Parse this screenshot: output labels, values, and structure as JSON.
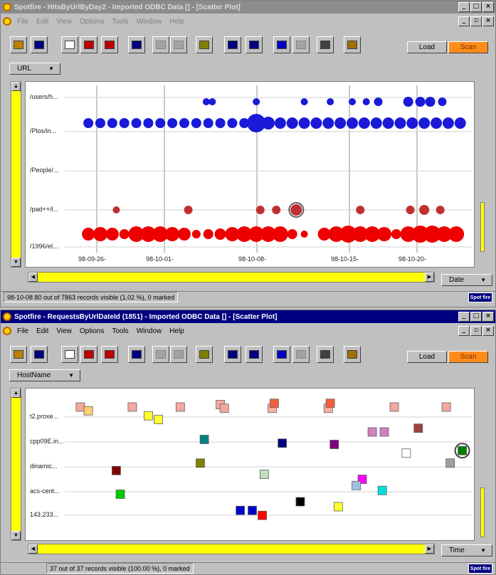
{
  "windows": [
    {
      "title": "Spotfire - HitsByUrlByDay2 - Imported ODBC Data [] - [Scatter Plot]",
      "menu": [
        "File",
        "Edit",
        "View",
        "Options",
        "Tools",
        "Window",
        "Help"
      ],
      "load_label": "Load",
      "scan_label": "Scan",
      "y_axis_selector": "URL",
      "x_axis_selector": "Date",
      "status": "98-10-08 80 out of 7863 records visible (1.02 %), 0 marked",
      "logo": "Spot fire"
    },
    {
      "title": "Spotfire - RequestsByUrlDateId (1851) - Imported ODBC Data [] - [Scatter Plot]",
      "menu": [
        "File",
        "Edit",
        "View",
        "Options",
        "Tools",
        "Window",
        "Help"
      ],
      "load_label": "Load",
      "scan_label": "Scan",
      "y_axis_selector": "HostName",
      "x_axis_selector": "Time",
      "status": "37 out of 37 records visible (100.00 %), 0 marked",
      "logo": "Spot fire"
    }
  ],
  "toolbar_icons": [
    "open-icon",
    "save-icon",
    "new-scatter-icon",
    "new-bar-icon",
    "new-pie-icon",
    "import-icon",
    "undo-icon",
    "zoom-icon",
    "query-device-icon",
    "copy-icon",
    "details-icon",
    "copy-to-clipboard-icon",
    "paste-icon",
    "print-icon",
    "help-icon"
  ],
  "chart_data": [
    {
      "type": "scatter",
      "y_categories": [
        "/users/h...",
        "/Plos/in...",
        "/People/...",
        "/pad++/l...",
        "/1996/el..."
      ],
      "x_ticks": [
        "98-09-26-",
        "98-10-01-",
        "98-10-08-",
        "98-10-15-",
        "98-10-20-"
      ],
      "colors": {
        "blue": "#1a1ad8",
        "red": "#ee0000",
        "darkred": "#c03030"
      },
      "series": [
        {
          "row": 0,
          "color": "blue",
          "x": [
            0.345,
            0.36,
            0.47,
            0.59,
            0.655,
            0.71,
            0.745,
            0.775,
            0.85,
            0.88,
            0.905,
            0.935
          ],
          "size": [
            5,
            5,
            5,
            5,
            5,
            5,
            5,
            6,
            7,
            7,
            7,
            6
          ]
        },
        {
          "row": 0.5,
          "color": "blue",
          "x": [
            0.05,
            0.08,
            0.11,
            0.14,
            0.17,
            0.2,
            0.23,
            0.26,
            0.29,
            0.32,
            0.35,
            0.38,
            0.41,
            0.44,
            0.47,
            0.5,
            0.53,
            0.56,
            0.59,
            0.62,
            0.65,
            0.68,
            0.71,
            0.74,
            0.77,
            0.8,
            0.83,
            0.86,
            0.89,
            0.92,
            0.95,
            0.98
          ],
          "size": [
            7,
            7,
            7,
            7,
            7,
            7,
            7,
            7,
            7,
            7,
            7,
            7,
            7,
            7,
            13,
            9,
            8,
            8,
            8,
            8,
            8,
            8,
            8,
            8,
            8,
            8,
            8,
            8,
            8,
            8,
            8,
            8
          ]
        },
        {
          "row": 3,
          "color": "darkred",
          "x": [
            0.12,
            0.3,
            0.48,
            0.52,
            0.57,
            0.73,
            0.855,
            0.89,
            0.93
          ],
          "size": [
            5,
            6,
            6,
            6,
            8,
            6,
            6,
            7,
            6
          ]
        },
        {
          "row": 3.98,
          "color": "red",
          "x": [
            0.05,
            0.08,
            0.11,
            0.14,
            0.17,
            0.2,
            0.23,
            0.26,
            0.29,
            0.32,
            0.35,
            0.38,
            0.41,
            0.44,
            0.47,
            0.5,
            0.53,
            0.56,
            0.59,
            0.64,
            0.67,
            0.7,
            0.73,
            0.76,
            0.79,
            0.82,
            0.85,
            0.88,
            0.91,
            0.94,
            0.97
          ],
          "size": [
            9,
            10,
            9,
            7,
            11,
            11,
            11,
            10,
            9,
            6,
            7,
            8,
            10,
            11,
            11,
            11,
            11,
            7,
            5,
            9,
            11,
            12,
            11,
            11,
            10,
            7,
            11,
            12,
            12,
            11,
            11
          ]
        }
      ]
    },
    {
      "type": "scatter",
      "y_categories": [
        "t2.proxe...",
        "cpp09E.in...",
        "dinamic...",
        "acs-cent...",
        "143.233..."
      ],
      "series": [
        {
          "color": "#f4a8a0",
          "x": [
            0.03
          ],
          "y": [
            -0.4
          ]
        },
        {
          "color": "#ffd070",
          "x": [
            0.05
          ],
          "y": [
            -0.25
          ]
        },
        {
          "color": "#f4a8a0",
          "x": [
            0.16
          ],
          "y": [
            -0.4
          ]
        },
        {
          "color": "#ffff30",
          "x": [
            0.2
          ],
          "y": [
            -0.05
          ]
        },
        {
          "color": "#ffff30",
          "x": [
            0.225
          ],
          "y": [
            0.1
          ]
        },
        {
          "color": "#f4a8a0",
          "x": [
            0.28
          ],
          "y": [
            -0.4
          ]
        },
        {
          "color": "#f4a8a0",
          "x": [
            0.38
          ],
          "y": [
            -0.5
          ]
        },
        {
          "color": "#f4a8a0",
          "x": [
            0.39
          ],
          "y": [
            -0.35
          ]
        },
        {
          "color": "#ffb0a0",
          "x": [
            0.51
          ],
          "y": [
            -0.35
          ]
        },
        {
          "color": "#f06040",
          "x": [
            0.515
          ],
          "y": [
            -0.55
          ]
        },
        {
          "color": "#ffb0a0",
          "x": [
            0.65
          ],
          "y": [
            -0.35
          ]
        },
        {
          "color": "#f06040",
          "x": [
            0.655
          ],
          "y": [
            -0.55
          ]
        },
        {
          "color": "#f4a8a0",
          "x": [
            0.815
          ],
          "y": [
            -0.4
          ]
        },
        {
          "color": "#f4a8a0",
          "x": [
            0.945
          ],
          "y": [
            -0.4
          ]
        },
        {
          "color": "#008080",
          "x": [
            0.34
          ],
          "y": [
            0.9
          ]
        },
        {
          "color": "#000080",
          "x": [
            0.535
          ],
          "y": [
            1.05
          ]
        },
        {
          "color": "#800080",
          "x": [
            0.665
          ],
          "y": [
            1.1
          ]
        },
        {
          "color": "#d080c0",
          "x": [
            0.76,
            0.79
          ],
          "y": [
            0.6,
            0.6
          ]
        },
        {
          "color": "#a04040",
          "x": [
            0.875
          ],
          "y": [
            0.45
          ]
        },
        {
          "color": "#ffffff",
          "x": [
            0.845
          ],
          "y": [
            1.45
          ]
        },
        {
          "color": "#008000",
          "x": [
            0.985
          ],
          "y": [
            1.35
          ]
        },
        {
          "color": "#a0a0a0",
          "x": [
            0.955
          ],
          "y": [
            1.85
          ]
        },
        {
          "color": "#800000",
          "x": [
            0.12
          ],
          "y": [
            2.15
          ]
        },
        {
          "color": "#808000",
          "x": [
            0.33
          ],
          "y": [
            1.85
          ]
        },
        {
          "color": "#c0e0c0",
          "x": [
            0.49
          ],
          "y": [
            2.3
          ]
        },
        {
          "color": "#ff00ff",
          "x": [
            0.735
          ],
          "y": [
            2.5
          ]
        },
        {
          "color": "#a0c0e0",
          "x": [
            0.72
          ],
          "y": [
            2.75
          ]
        },
        {
          "color": "#00e0e0",
          "x": [
            0.785
          ],
          "y": [
            2.95
          ]
        },
        {
          "color": "#00cc00",
          "x": [
            0.13
          ],
          "y": [
            3.1
          ]
        },
        {
          "color": "#000000",
          "x": [
            0.58
          ],
          "y": [
            3.4
          ]
        },
        {
          "color": "#ffff30",
          "x": [
            0.675
          ],
          "y": [
            3.6
          ]
        },
        {
          "color": "#0000cc",
          "x": [
            0.43,
            0.46
          ],
          "y": [
            3.75,
            3.75
          ]
        },
        {
          "color": "#ff0000",
          "x": [
            0.485
          ],
          "y": [
            3.95
          ]
        }
      ]
    }
  ]
}
